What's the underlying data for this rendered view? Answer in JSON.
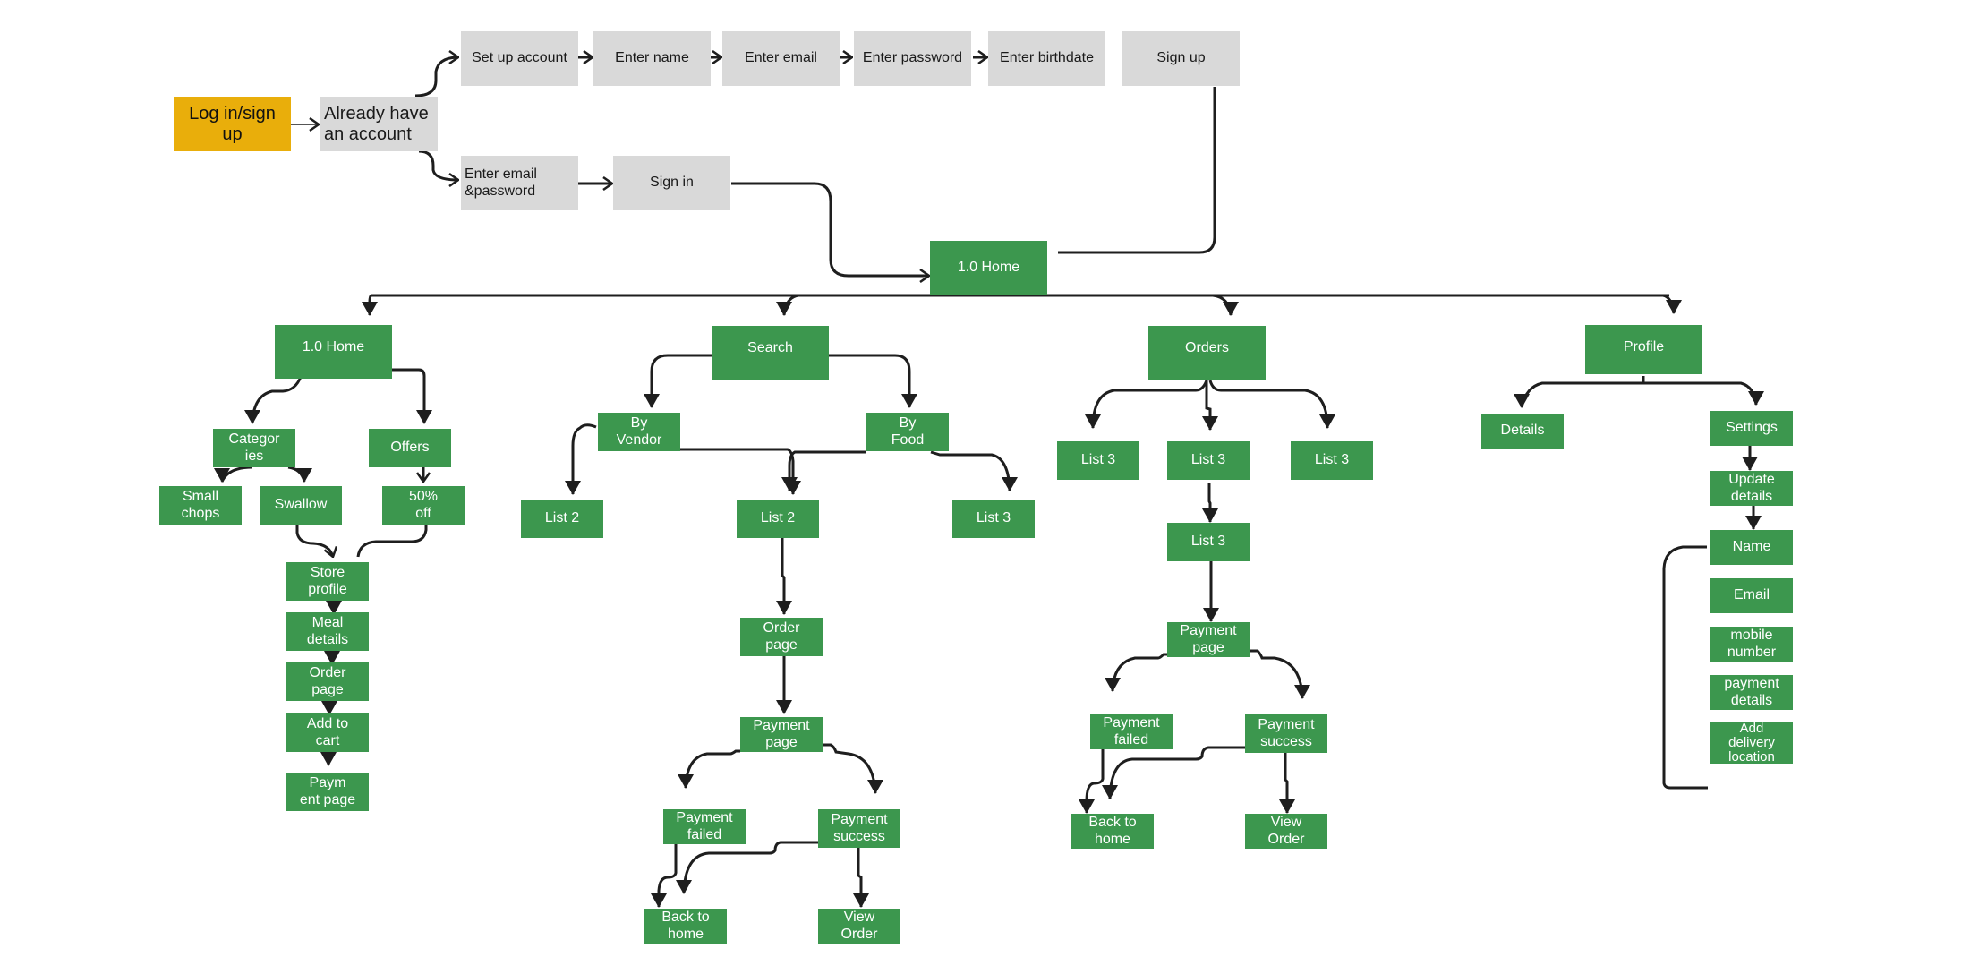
{
  "colors": {
    "start": "#e9ae0b",
    "auth_step": "#d9d9d9",
    "screen": "#3c974e",
    "connector": "#1e1e1e"
  },
  "auth": {
    "start": "Log in/sign up",
    "already_have_account": "Already have\nan account",
    "signup_flow": [
      "Set up account",
      "Enter name",
      "Enter email",
      "Enter password",
      "Enter birthdate",
      "Sign up"
    ],
    "signin_flow": [
      "Enter email\n&password",
      "Sign in"
    ]
  },
  "hub": {
    "label": "1.0 Home"
  },
  "branches": {
    "home": {
      "label": "1.0 Home",
      "categories": "Categor\nies",
      "offers": "Offers",
      "small_chops": "Small\nchops",
      "swallow": "Swallow",
      "fifty_off": "50%\noff",
      "chain": [
        "Store\nprofile",
        "Meal\ndetails",
        "Order\npage",
        "Add to\ncart",
        "Paym\nent page"
      ]
    },
    "search": {
      "label": "Search",
      "by_vendor": "By\nVendor",
      "by_food": "By\nFood",
      "list_left": "List 2",
      "list_mid": "List 2",
      "list_right": "List 3",
      "order_page": "Order\npage",
      "payment_page": "Payment\npage",
      "payment_failed": "Payment\nfailed",
      "payment_success": "Payment\nsuccess",
      "back_home": "Back to\nhome",
      "view_order": "View\nOrder"
    },
    "orders": {
      "label": "Orders",
      "lists": [
        "List 3",
        "List 3",
        "List 3"
      ],
      "list_sub": "List 3",
      "payment_page": "Payment\npage",
      "payment_failed": "Payment\nfailed",
      "payment_success": "Payment\nsuccess",
      "back_home": "Back to\nhome",
      "view_order": "View\nOrder"
    },
    "profile": {
      "label": "Profile",
      "details": "Details",
      "settings": "Settings",
      "update_details": "Update\ndetails",
      "fields": [
        "Name",
        "Email",
        "mobile\nnumber",
        "payment\ndetails",
        "Add\ndelivery\nlocation"
      ]
    }
  }
}
